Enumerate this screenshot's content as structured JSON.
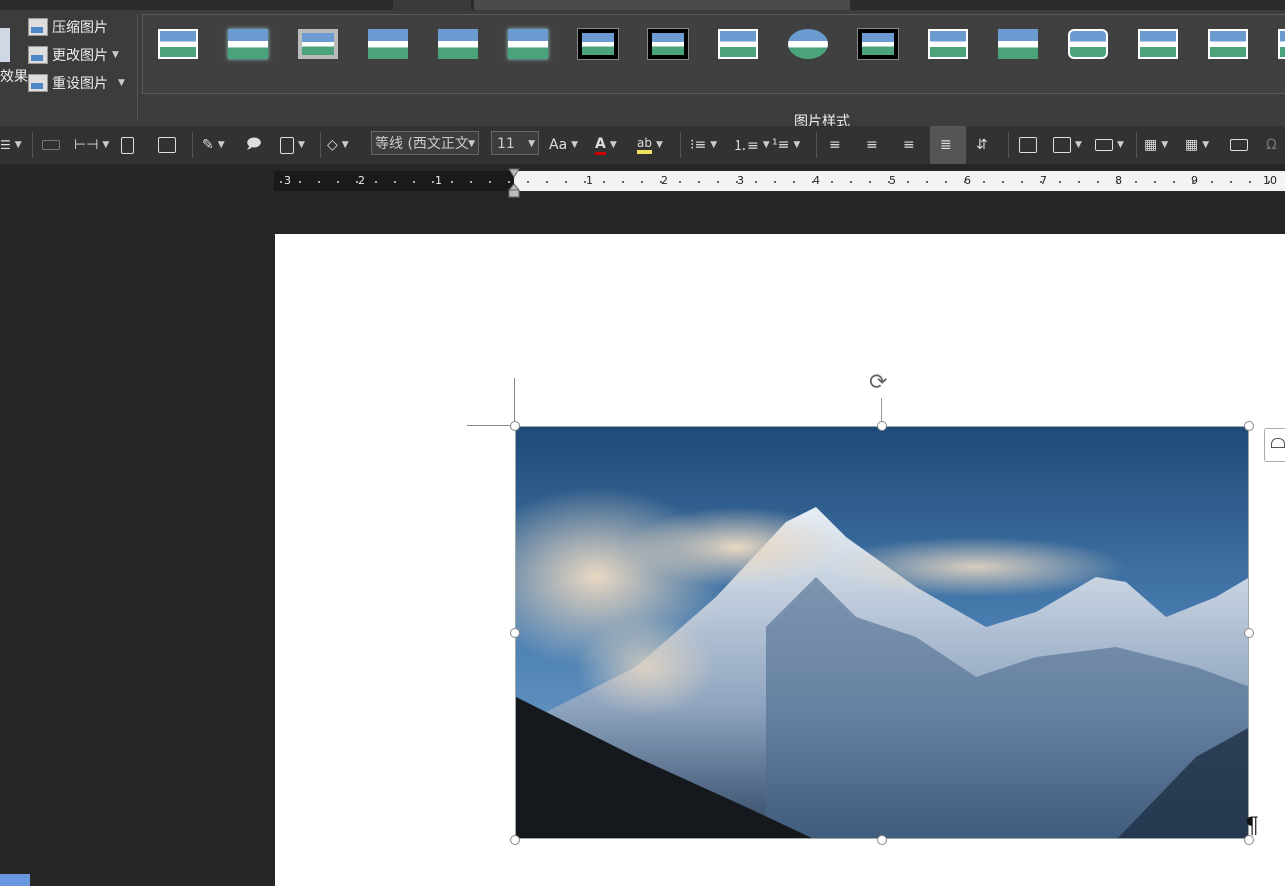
{
  "ribbon": {
    "compress_label": "压缩图片",
    "change_label": "更改图片",
    "reset_label": "重设图片",
    "effect_label": "效果",
    "gallery_label": "图片样式",
    "gallery_styles": [
      "simple-frame",
      "soft-frame",
      "thick-grey",
      "drop-shadow",
      "reflected",
      "soft-edge",
      "black-double",
      "thick-black",
      "white-frame",
      "oval-reflect",
      "metal-frame",
      "rotated-white",
      "perspective",
      "rounded-diagonal",
      "snip-diagonal",
      "center-shadow",
      "beveled"
    ]
  },
  "toolbar": {
    "font_name": "等线 (西文正文",
    "font_size": "11",
    "case_label": "Aa",
    "font_color_label": "A",
    "highlight_label": "ab"
  },
  "ruler": {
    "left_numbers": [
      "3",
      "2",
      "1"
    ],
    "right_numbers": [
      "1",
      "2",
      "3",
      "4",
      "5",
      "6",
      "7",
      "8",
      "9",
      "10"
    ]
  },
  "document": {
    "pilcrow": "¶"
  },
  "colors": {
    "ribbon_bg": "#3c3c3c",
    "app_bg": "#262626",
    "accent": "#6a98e0"
  }
}
